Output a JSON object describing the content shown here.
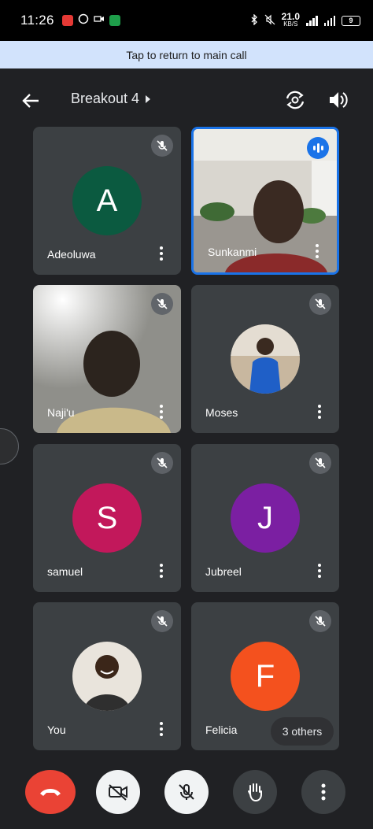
{
  "status_bar": {
    "time": "11:26",
    "net_speed": "21.0",
    "net_unit": "KB/S",
    "battery": "9"
  },
  "banner": {
    "text": "Tap to return to main call"
  },
  "header": {
    "title": "Breakout 4"
  },
  "participants": [
    {
      "name": "Adeoluwa",
      "initial": "A",
      "color": "#0b5a40",
      "mic": "muted",
      "kind": "letter"
    },
    {
      "name": "Sunkanmi",
      "mic": "speaking",
      "kind": "video",
      "active": true
    },
    {
      "name": "Naji'u",
      "mic": "muted",
      "kind": "video"
    },
    {
      "name": "Moses",
      "mic": "muted",
      "kind": "photo"
    },
    {
      "name": "samuel",
      "initial": "S",
      "color": "#c2185b",
      "mic": "muted",
      "kind": "letter"
    },
    {
      "name": "Jubreel",
      "initial": "J",
      "color": "#7b1fa2",
      "mic": "muted",
      "kind": "letter"
    },
    {
      "name": "You",
      "mic": "muted",
      "kind": "photo"
    },
    {
      "name": "Felicia",
      "initial": "F",
      "color": "#f4511e",
      "mic": "muted",
      "kind": "letter"
    }
  ],
  "others_chip": "3 others",
  "controls": {
    "end_call_color": "#ea4335",
    "buttons": [
      "end-call",
      "camera-off",
      "mic-off",
      "raise-hand",
      "more-options"
    ]
  },
  "colors": {
    "background": "#202124",
    "tile": "#3c4043",
    "accent": "#1a73e8",
    "banner": "#d2e3fc"
  }
}
